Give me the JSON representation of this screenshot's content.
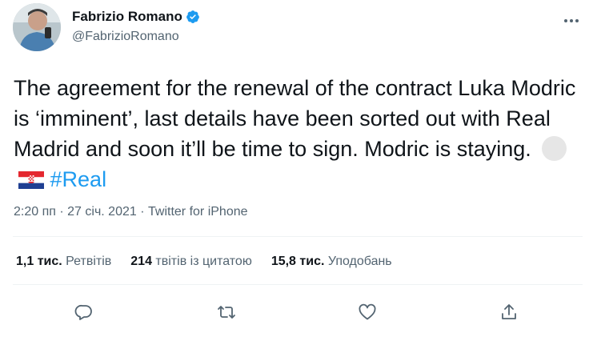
{
  "author": {
    "name": "Fabrizio Romano",
    "handle": "@FabrizioRomano",
    "verified": true
  },
  "tweet": {
    "text": "The agreement for the renewal of the contract Luka Modric is ‘imminent’, last details have been sorted out with Real Madrid and soon it’ll be time to sign. Modric is staying.",
    "hashtag": "#Real",
    "emojis": [
      "circle-emoji",
      "croatia-flag-emoji"
    ]
  },
  "meta": {
    "time": "2:20 пп",
    "separator": "·",
    "date": "27 січ. 2021",
    "source": "Twitter for iPhone"
  },
  "stats": {
    "retweets": {
      "value": "1,1 тис.",
      "label": "Ретвітів"
    },
    "quotes": {
      "value": "214",
      "label": "твітів із цитатою"
    },
    "likes": {
      "value": "15,8 тис.",
      "label": "Уподобань"
    }
  },
  "actions": [
    "reply-icon",
    "retweet-icon",
    "like-icon",
    "share-icon"
  ],
  "colors": {
    "accent": "#1d9bf0",
    "text": "#0f1419",
    "secondary": "#536471",
    "divider": "#eff3f4"
  }
}
